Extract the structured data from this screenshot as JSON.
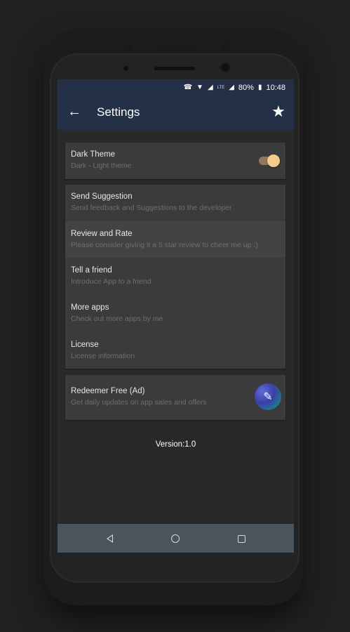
{
  "status_bar": {
    "signal_icon": "signal-icon",
    "wifi_icon": "wifi-icon",
    "cell_icon": "cellular-icon",
    "lte": "LTE",
    "battery_percent": "80%",
    "battery_icon": "battery-icon",
    "time": "10:48"
  },
  "app_bar": {
    "title": "Settings",
    "back_icon": "back-arrow-icon",
    "star_icon": "star-icon",
    "color": "#233045"
  },
  "theme_card": {
    "title": "Dark Theme",
    "subtitle": "Dark - Light theme",
    "toggle_on": true,
    "accent": "#f6c98d"
  },
  "menu_items": [
    {
      "title": "Send Suggestion",
      "subtitle": "Send feedback and Suggestions to the developer"
    },
    {
      "title": "Review and Rate",
      "subtitle": "Please consider giving it a 5 star review to cheer me up :)"
    },
    {
      "title": "Tell a friend",
      "subtitle": "Introduce App to a friend"
    },
    {
      "title": "More apps",
      "subtitle": "Check out more apps by me"
    },
    {
      "title": "License",
      "subtitle": "License information"
    }
  ],
  "ad_card": {
    "title": "Redeemer Free (Ad)",
    "subtitle": "Get daily updates on app sales and offers",
    "icon": "redeemer-app-icon"
  },
  "version": "Version:1.0",
  "nav_bar": {
    "back": "nav-back-icon",
    "home": "nav-home-icon",
    "recent": "nav-recent-icon"
  }
}
